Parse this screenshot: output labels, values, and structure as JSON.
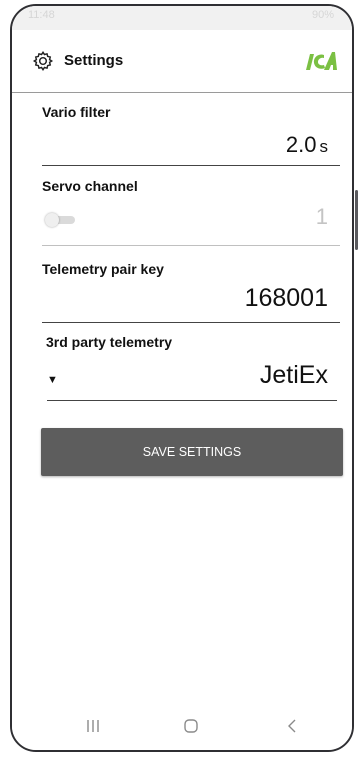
{
  "status_bar": {
    "time": "11:48",
    "battery": "90%"
  },
  "app_bar": {
    "title": "Settings",
    "logo_alt": "ICA",
    "logo_color": "#7bc043"
  },
  "fields": {
    "vario_filter": {
      "label": "Vario filter",
      "value": "2.0",
      "unit": "s"
    },
    "servo_channel": {
      "label": "Servo channel",
      "value": "1",
      "toggle_on": false
    },
    "telemetry_pair_key": {
      "label": "Telemetry pair key",
      "value": "168001"
    },
    "third_party_telemetry": {
      "label": "3rd party telemetry",
      "value": "JetiEx"
    }
  },
  "save_button": {
    "label": "SAVE SETTINGS",
    "color": "#5d5d5d"
  },
  "nav_bar": {
    "recents_icon": "recents-icon",
    "home_icon": "home-icon",
    "back_icon": "back-icon"
  }
}
